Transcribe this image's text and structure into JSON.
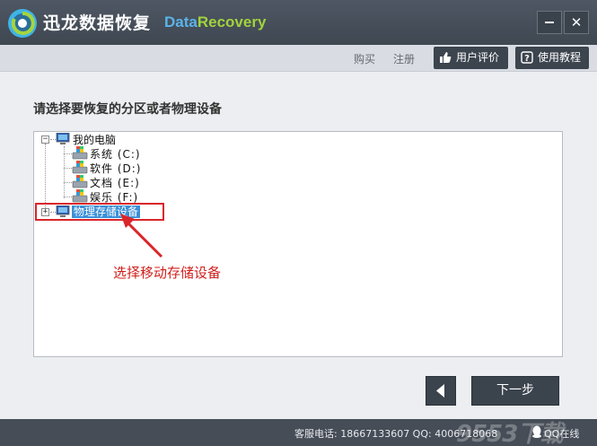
{
  "titlebar": {
    "title": "迅龙数据恢复",
    "brand_part1": "Data",
    "brand_part2": "Recovery",
    "minimize_icon": "minimize-icon",
    "close_label": "✕"
  },
  "toolbar": {
    "buy_label": "购买",
    "register_label": "注册",
    "review_label": "用户评价",
    "tutorial_label": "使用教程"
  },
  "main": {
    "prompt": "请选择要恢复的分区或者物理设备",
    "tree": {
      "root_label": "我的电脑",
      "drives": [
        {
          "label": "系统 (C:)"
        },
        {
          "label": "软件 (D:)"
        },
        {
          "label": "文档 (E:)"
        },
        {
          "label": "娱乐 (F:)"
        }
      ],
      "physical_label": "物理存储设备"
    },
    "annotation": "选择移动存储设备"
  },
  "buttons": {
    "back_icon": "arrow-left-icon",
    "next_label": "下一步"
  },
  "statusbar": {
    "phone_text": "客服电话: 18667133607 QQ: 4006718068",
    "qq_label": "QQ在线",
    "watermark": "9553下载"
  },
  "colors": {
    "titlebar": "#444c57",
    "brand_blue": "#5ab4e8",
    "brand_green": "#a2d23c",
    "annotation_red": "#d9262a",
    "selection_blue": "#3a8fd8"
  }
}
